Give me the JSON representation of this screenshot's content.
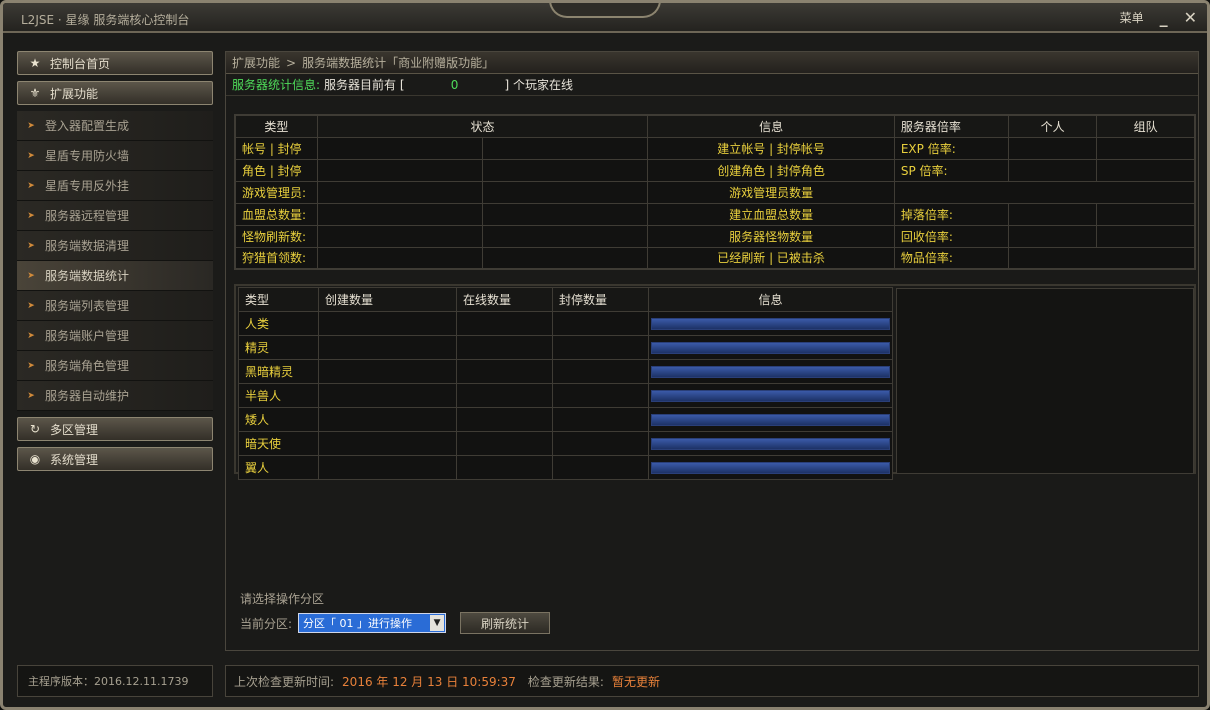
{
  "window": {
    "title": "L2JSE · 星缘 服务端核心控制台",
    "menu_label": "菜单",
    "minimize_icon": "minimize-icon",
    "close_icon": "close-icon"
  },
  "sidebar": {
    "home": {
      "label": "控制台首页",
      "icon": "star-icon"
    },
    "extend": {
      "label": "扩展功能",
      "icon": "fleur-de-lis-icon"
    },
    "items": [
      {
        "label": "登入器配置生成",
        "active": false
      },
      {
        "label": "星盾专用防火墙",
        "active": false
      },
      {
        "label": "星盾专用反外挂",
        "active": false
      },
      {
        "label": "服务器远程管理",
        "active": false
      },
      {
        "label": "服务端数据清理",
        "active": false
      },
      {
        "label": "服务端数据统计",
        "active": true
      },
      {
        "label": "服务端列表管理",
        "active": false
      },
      {
        "label": "服务端账户管理",
        "active": false
      },
      {
        "label": "服务端角色管理",
        "active": false
      },
      {
        "label": "服务器自动维护",
        "active": false
      }
    ],
    "multi_zone": {
      "label": "多区管理",
      "icon": "refresh-icon"
    },
    "system": {
      "label": "系统管理",
      "icon": "eye-icon"
    }
  },
  "version": {
    "text": "主程序版本：2016.12.11.1739"
  },
  "main": {
    "breadcrumb": {
      "part1": "扩展功能",
      "sep": ">",
      "part2": "服务端数据统计「商业附赠版功能」"
    },
    "info": {
      "label": "服务器统计信息:",
      "prefix": "服务器目前有 [",
      "count": "0",
      "suffix": "] 个玩家在线"
    },
    "stats_table": {
      "headers": {
        "type": "类型",
        "status": "状态",
        "info": "信息",
        "rate": "服务器倍率",
        "personal": "个人",
        "party": "组队"
      },
      "rows": [
        {
          "type": "帐号 | 封停",
          "info": "建立帐号 | 封停帐号",
          "rate": "EXP 倍率:"
        },
        {
          "type": "角色 | 封停",
          "info": "创建角色 | 封停角色",
          "rate": "SP  倍率:"
        },
        {
          "type": "游戏管理员:",
          "info": "游戏管理员数量",
          "rate": ""
        },
        {
          "type": "血盟总数量:",
          "info": "建立血盟总数量",
          "rate": "掉落倍率:"
        },
        {
          "type": "怪物刷新数:",
          "info": "服务器怪物数量",
          "rate": "回收倍率:"
        },
        {
          "type": "狩猎首领数:",
          "info": "已经刷新 | 已被击杀",
          "rate": "物品倍率:"
        }
      ]
    },
    "race_table": {
      "headers": {
        "type": "类型",
        "created": "创建数量",
        "online": "在线数量",
        "banned": "封停数量",
        "info": "信息"
      },
      "rows": [
        {
          "type": "人类",
          "ratio": 1.0
        },
        {
          "type": "精灵",
          "ratio": 1.0
        },
        {
          "type": "黑暗精灵",
          "ratio": 1.0
        },
        {
          "type": "半兽人",
          "ratio": 1.0
        },
        {
          "type": "矮人",
          "ratio": 1.0
        },
        {
          "type": "暗天使",
          "ratio": 1.0
        },
        {
          "type": "翼人",
          "ratio": 1.0
        }
      ]
    },
    "operation": {
      "title": "请选择操作分区",
      "current_label": "当前分区:",
      "select_value": "分区「 01 」进行操作",
      "refresh_button": "刷新统计"
    }
  },
  "footer": {
    "last_check_label": "上次检查更新时间:",
    "last_check_time": "2016 年 12 月 13 日 10:59:37",
    "result_label": "检查更新结果:",
    "result_value": "暂无更新"
  },
  "colors": {
    "highlight_yellow": "#e8cf3d",
    "green": "#4fdc5a",
    "orange": "#e8813a",
    "bar_blue": "#2a4a96"
  }
}
